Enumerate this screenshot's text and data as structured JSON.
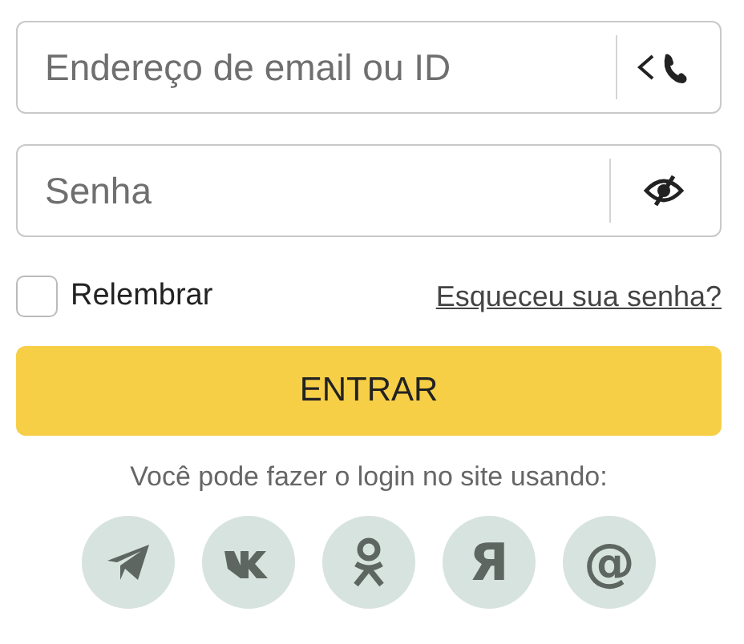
{
  "email_field": {
    "placeholder": "Endereço de email ou ID"
  },
  "password_field": {
    "placeholder": "Senha"
  },
  "remember": {
    "label": "Relembrar",
    "checked": false
  },
  "forgot_link": "Esqueceu sua senha?",
  "login_button": "ENTRAR",
  "social_caption": "Você pode fazer o login no site usando:",
  "social": [
    {
      "kind": "telegram"
    },
    {
      "kind": "vk"
    },
    {
      "kind": "ok"
    },
    {
      "kind": "glyph",
      "text": "Я"
    },
    {
      "kind": "glyph",
      "text": "@"
    }
  ]
}
